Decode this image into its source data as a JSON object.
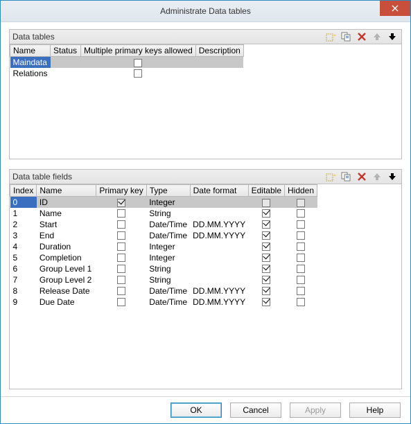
{
  "window": {
    "title": "Administrate Data tables"
  },
  "toolbar_icons": {
    "new": "new-icon",
    "copy": "copy-icon",
    "delete": "delete-icon",
    "up": "up-icon",
    "down": "down-icon"
  },
  "tables_panel": {
    "title": "Data tables",
    "columns": {
      "name": "Name",
      "status": "Status",
      "multi_pk": "Multiple primary keys allowed",
      "description": "Description"
    },
    "rows": [
      {
        "name": "Maindata",
        "status": "",
        "multi_pk": false,
        "description": "",
        "selected": true
      },
      {
        "name": "Relations",
        "status": "",
        "multi_pk": false,
        "description": "",
        "selected": false
      }
    ]
  },
  "fields_panel": {
    "title": "Data table fields",
    "columns": {
      "index": "Index",
      "name": "Name",
      "pk": "Primary key",
      "type": "Type",
      "datefmt": "Date format",
      "editable": "Editable",
      "hidden": "Hidden"
    },
    "rows": [
      {
        "index": "0",
        "name": "ID",
        "pk": true,
        "pk_disabled": true,
        "type": "Integer",
        "datefmt": "",
        "editable": false,
        "editable_disabled": true,
        "hidden": false,
        "hidden_disabled": true,
        "selected": true
      },
      {
        "index": "1",
        "name": "Name",
        "pk": false,
        "type": "String",
        "datefmt": "",
        "editable": true,
        "hidden": false
      },
      {
        "index": "2",
        "name": "Start",
        "pk": false,
        "type": "Date/Time",
        "datefmt": "DD.MM.YYYY",
        "editable": true,
        "hidden": false
      },
      {
        "index": "3",
        "name": "End",
        "pk": false,
        "type": "Date/Time",
        "datefmt": "DD.MM.YYYY",
        "editable": true,
        "hidden": false
      },
      {
        "index": "4",
        "name": "Duration",
        "pk": false,
        "type": "Integer",
        "datefmt": "",
        "editable": true,
        "hidden": false
      },
      {
        "index": "5",
        "name": "Completion",
        "pk": false,
        "type": "Integer",
        "datefmt": "",
        "editable": true,
        "hidden": false
      },
      {
        "index": "6",
        "name": "Group Level 1",
        "pk": false,
        "type": "String",
        "datefmt": "",
        "editable": true,
        "hidden": false
      },
      {
        "index": "7",
        "name": "Group Level 2",
        "pk": false,
        "type": "String",
        "datefmt": "",
        "editable": true,
        "hidden": false
      },
      {
        "index": "8",
        "name": "Release Date",
        "pk": false,
        "type": "Date/Time",
        "datefmt": "DD.MM.YYYY",
        "editable": true,
        "hidden": false
      },
      {
        "index": "9",
        "name": "Due Date",
        "pk": false,
        "type": "Date/Time",
        "datefmt": "DD.MM.YYYY",
        "editable": true,
        "hidden": false
      }
    ]
  },
  "buttons": {
    "ok": "OK",
    "cancel": "Cancel",
    "apply": "Apply",
    "help": "Help"
  }
}
